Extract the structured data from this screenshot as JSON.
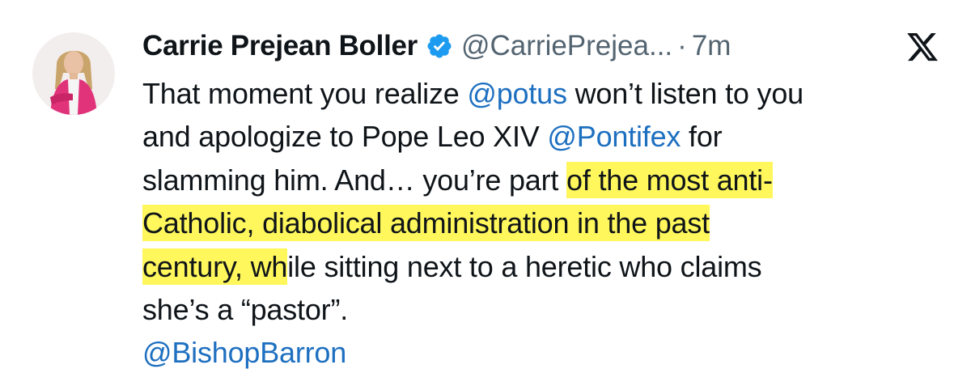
{
  "author": {
    "display_name": "Carrie Prejean Boller",
    "handle": "@CarriePrejea...",
    "separator": "·",
    "time_ago": "7m"
  },
  "tweet": {
    "line1": {
      "t1": "That moment you realize ",
      "m1": "@potus",
      "t2": " won’t listen to you"
    },
    "line2": {
      "t1": "and apologize to Pope Leo XIV ",
      "m1": "@Pontifex",
      "t2": " for"
    },
    "line3": {
      "t1": "slamming him. And… you’re part ",
      "h1": "of the most anti-"
    },
    "line4": {
      "h1": "Catholic, diabolical administration in the past"
    },
    "line5": {
      "h1": "century, wh",
      "t1": "ile sitting next to a heretic who claims"
    },
    "line6": {
      "t1": "she’s a “pastor”."
    },
    "tag": "@BishopBarron"
  },
  "colors": {
    "mention": "#1d6fc0",
    "highlight": "#fff640",
    "secondary_text": "#536471",
    "verified": "#1d9bf0"
  },
  "icons": {
    "verified": "verified-badge-icon",
    "platform": "x-logo-icon"
  }
}
